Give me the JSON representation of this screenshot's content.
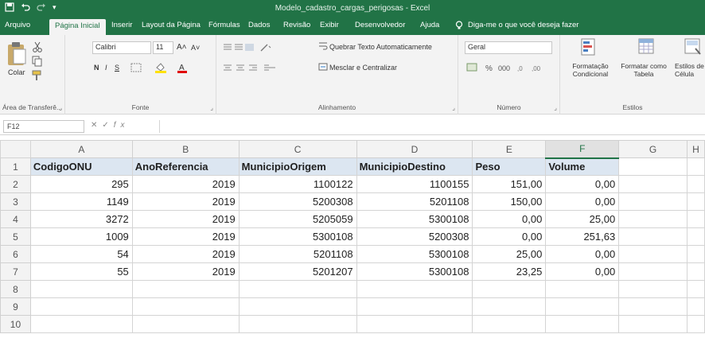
{
  "window": {
    "title": "Modelo_cadastro_cargas_perigosas - Excel",
    "quick_access": [
      "save-icon",
      "undo-icon",
      "redo-icon",
      "customize-icon"
    ]
  },
  "tabs": [
    "Arquivo",
    "Página Inicial",
    "Inserir",
    "Layout da Página",
    "Fórmulas",
    "Dados",
    "Revisão",
    "Exibir",
    "Desenvolvedor",
    "Ajuda"
  ],
  "active_tab": "Página Inicial",
  "tell_me": "Diga-me o que você deseja fazer",
  "ribbon": {
    "clipboard": {
      "paste_label": "Colar",
      "group_label": "Área de Transferê..."
    },
    "font": {
      "font_name": "Calibri",
      "font_size": "11",
      "bold": "N",
      "italic": "I",
      "underline": "S",
      "group_label": "Fonte"
    },
    "alignment": {
      "wrap_text": "Quebrar Texto Automaticamente",
      "merge_center": "Mesclar e Centralizar",
      "group_label": "Alinhamento"
    },
    "number": {
      "format": "Geral",
      "group_label": "Número"
    },
    "styles": {
      "conditional": "Formatação Condicional",
      "format_table": "Formatar como Tabela",
      "cell_styles": "Estilos de Célula",
      "group_label": "Estilos"
    }
  },
  "formula_bar": {
    "name_box": "F12",
    "fx": "fx",
    "value": ""
  },
  "sheet": {
    "columns": [
      "A",
      "B",
      "C",
      "D",
      "E",
      "F",
      "G",
      "H"
    ],
    "selected_column": "F",
    "row_numbers": [
      "1",
      "2",
      "3",
      "4",
      "5",
      "6",
      "7",
      "8",
      "9",
      "10"
    ],
    "headers": [
      "CodigoONU",
      "AnoReferencia",
      "MunicipioOrigem",
      "MunicipioDestino",
      "Peso",
      "Volume"
    ],
    "rows": [
      [
        "295",
        "2019",
        "1100122",
        "1100155",
        "151,00",
        "0,00"
      ],
      [
        "1149",
        "2019",
        "5200308",
        "5201108",
        "150,00",
        "0,00"
      ],
      [
        "3272",
        "2019",
        "5205059",
        "5300108",
        "0,00",
        "25,00"
      ],
      [
        "1009",
        "2019",
        "5300108",
        "5200308",
        "0,00",
        "251,63"
      ],
      [
        "54",
        "2019",
        "5201108",
        "5300108",
        "25,00",
        "0,00"
      ],
      [
        "55",
        "2019",
        "5201207",
        "5300108",
        "23,25",
        "0,00"
      ]
    ]
  },
  "colors": {
    "brand": "#217346",
    "header_fill": "#dce6f1"
  }
}
